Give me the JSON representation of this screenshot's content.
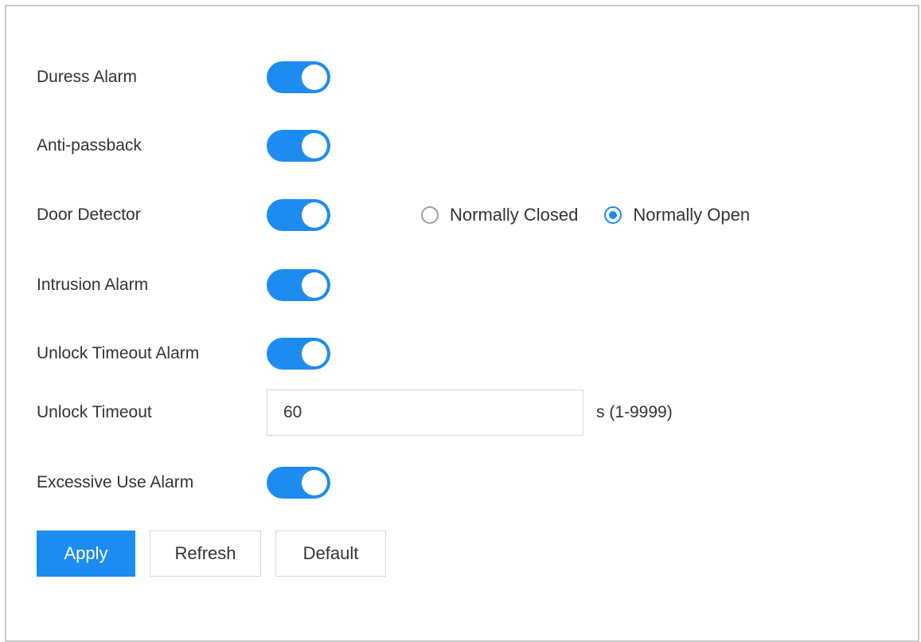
{
  "rows": [
    {
      "label": "Duress Alarm",
      "enabled": true
    },
    {
      "label": "Anti-passback",
      "enabled": true
    },
    {
      "label": "Door Detector",
      "enabled": true
    },
    {
      "label": "Intrusion Alarm",
      "enabled": true
    },
    {
      "label": "Unlock Timeout Alarm",
      "enabled": true
    }
  ],
  "door_detector": {
    "options": [
      {
        "label": "Normally Closed",
        "checked": false
      },
      {
        "label": "Normally Open",
        "checked": true
      }
    ]
  },
  "unlock_timeout": {
    "label": "Unlock Timeout",
    "value": "60",
    "unit": "s (1-9999)"
  },
  "excessive_use": {
    "label": "Excessive Use Alarm",
    "enabled": true
  },
  "buttons": {
    "apply": "Apply",
    "refresh": "Refresh",
    "default": "Default"
  },
  "colors": {
    "accent": "#1d8cf0",
    "border": "#d9d9d9",
    "text": "#333333"
  }
}
